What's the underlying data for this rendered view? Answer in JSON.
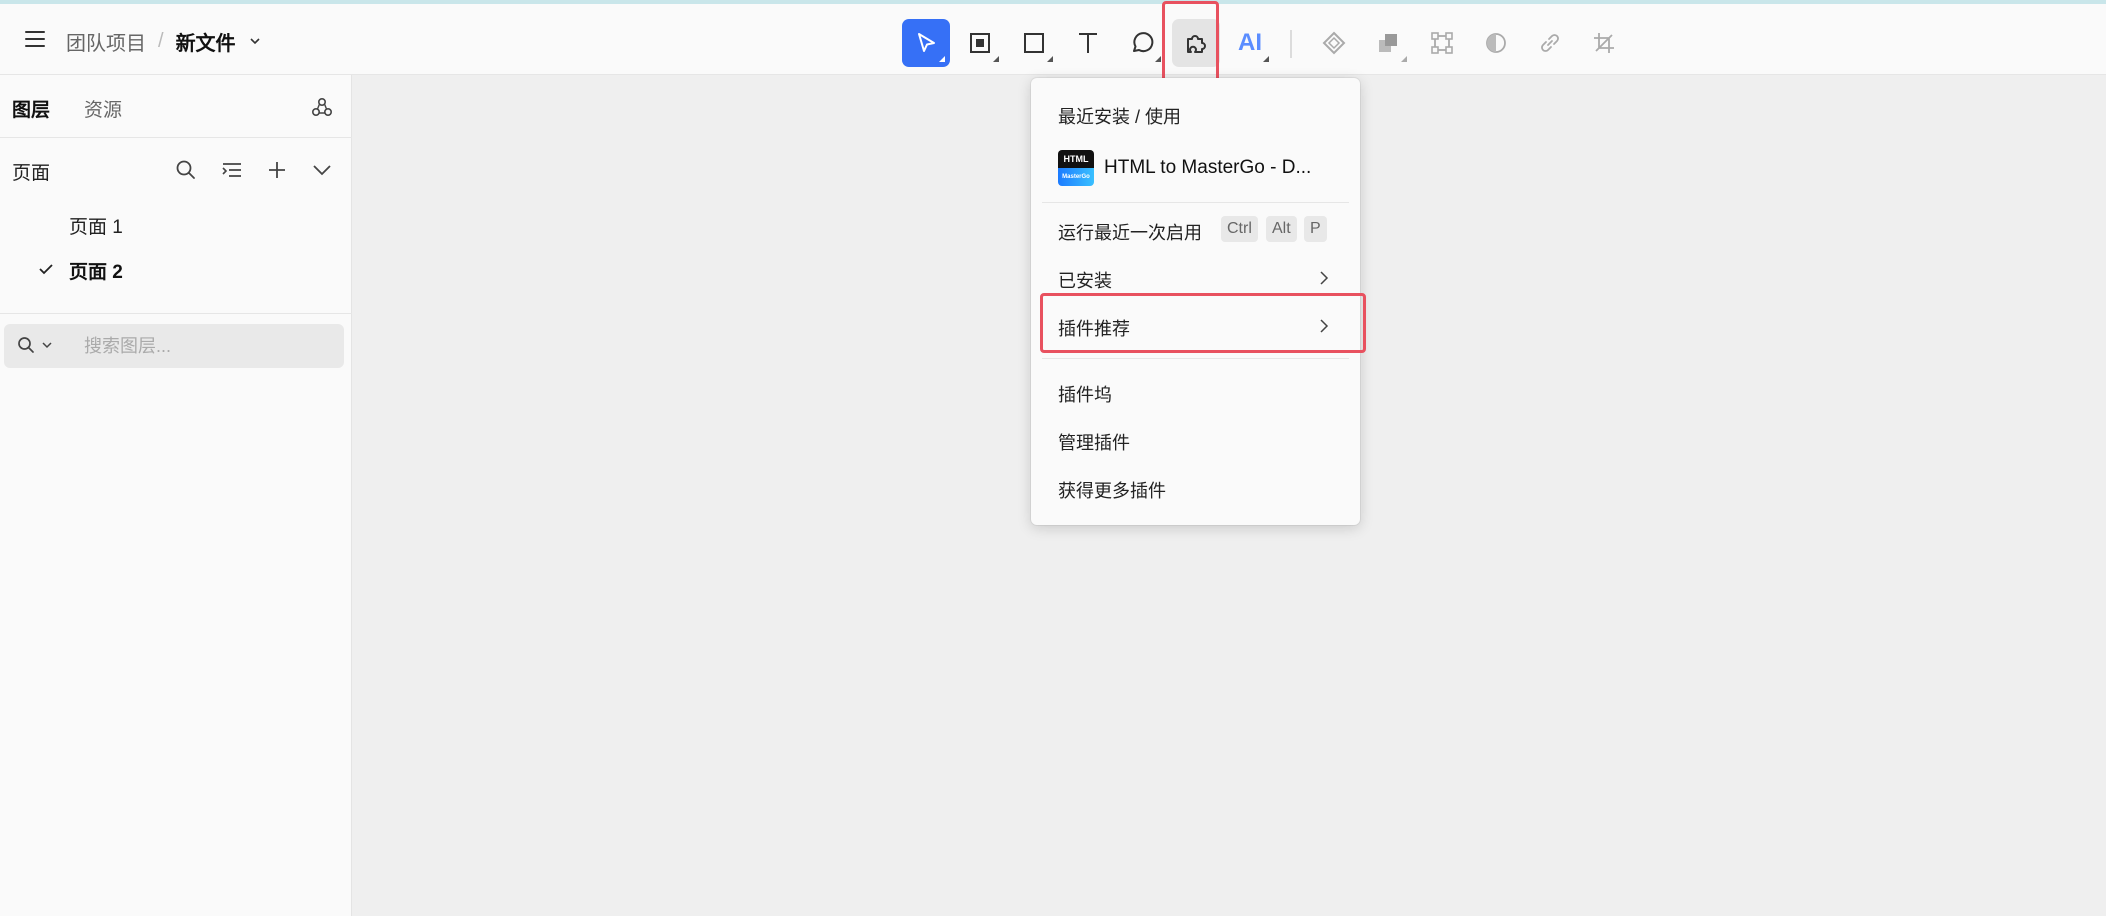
{
  "header": {
    "project": "团队项目",
    "separator": "/",
    "file_name": "新文件"
  },
  "toolbar": {
    "tools": [
      {
        "name": "move-tool",
        "icon": "cursor-arrow-icon",
        "active": true
      },
      {
        "name": "frame-tool",
        "icon": "frame-icon"
      },
      {
        "name": "rectangle-tool",
        "icon": "rectangle-icon"
      },
      {
        "name": "text-tool",
        "icon": "text-icon"
      },
      {
        "name": "comment-tool",
        "icon": "comment-bubble-icon"
      },
      {
        "name": "plugin-tool",
        "icon": "puzzle-icon",
        "open": true
      },
      {
        "name": "ai-tool",
        "icon": "ai-icon"
      },
      {
        "name": "component-tool",
        "icon": "component-diamond-icon"
      },
      {
        "name": "boolean-tool",
        "icon": "boolean-icon"
      },
      {
        "name": "vector-edit-tool",
        "icon": "vector-nodes-icon"
      },
      {
        "name": "mask-tool",
        "icon": "mask-icon"
      },
      {
        "name": "link-tool",
        "icon": "link-icon"
      },
      {
        "name": "crop-tool",
        "icon": "crop-icon"
      }
    ],
    "ai_label": "AI"
  },
  "sidebar": {
    "tabs": [
      "图层",
      "资源"
    ],
    "pages_label": "页面",
    "pages": [
      {
        "label": "页面 1",
        "selected": false
      },
      {
        "label": "页面 2",
        "selected": true
      }
    ],
    "search_placeholder": "搜索图层..."
  },
  "plugin_menu": {
    "recent_heading": "最近安装 / 使用",
    "recent_plugin": "HTML to MasterGo - D...",
    "plugin_thumb_top": "HTML",
    "plugin_thumb_bottom": "MasterGo",
    "run_last": "运行最近一次启用",
    "shortcut": [
      "Ctrl",
      "Alt",
      "P"
    ],
    "installed": "已安装",
    "recommended": "插件推荐",
    "plugin_dock": "插件坞",
    "manage": "管理插件",
    "get_more": "获得更多插件"
  },
  "colors": {
    "accent": "#3670f6",
    "highlight": "#e8515f"
  }
}
